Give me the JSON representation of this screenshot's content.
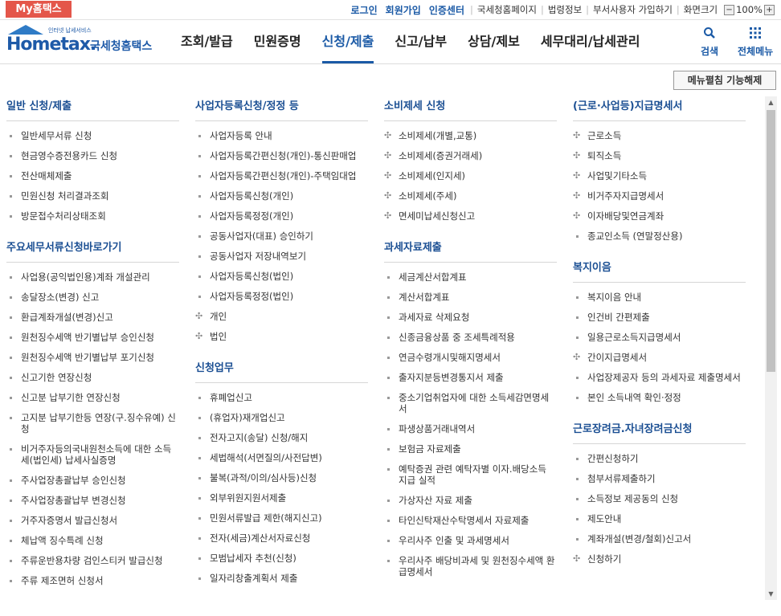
{
  "topbar": {
    "mytax": "My홈택스",
    "links_blue": [
      "로그인",
      "회원가입",
      "인증센터"
    ],
    "links_plain": [
      "국세청홈페이지",
      "법령정보",
      "부서사용자 가입하기",
      "화면크기"
    ],
    "zoom": "100%",
    "zoom_minus": "−",
    "zoom_plus": "+"
  },
  "header": {
    "logo_en": "Hometax.",
    "logo_small": "인터넷 납세서비스",
    "logo_ko": "국세청홈택스",
    "nav": [
      "조회/발급",
      "민원증명",
      "신청/제출",
      "신고/납부",
      "상담/제보",
      "세무대리/납세관리"
    ],
    "active_nav": "신청/제출",
    "search_label": "검색",
    "allmenu_label": "전체메뉴"
  },
  "menu_toggle": "메뉴펼침 기능해제",
  "columns": [
    {
      "sections": [
        {
          "title": "일반 신청/제출",
          "items": [
            {
              "label": "일반세무서류 신청",
              "mark": "bullet"
            },
            {
              "label": "현금영수증전용카드 신청",
              "mark": "bullet"
            },
            {
              "label": "전산매체제출",
              "mark": "bullet"
            },
            {
              "label": "민원신청 처리결과조회",
              "mark": "bullet"
            },
            {
              "label": "방문접수처리상태조회",
              "mark": "bullet"
            }
          ]
        },
        {
          "title": "주요세무서류신청바로가기",
          "items": [
            {
              "label": "사업용(공익법인용)계좌 개설관리",
              "mark": "bullet"
            },
            {
              "label": "송달장소(변경) 신고",
              "mark": "bullet"
            },
            {
              "label": "환급계좌개설(변경)신고",
              "mark": "bullet"
            },
            {
              "label": "원천징수세액 반기별납부 승인신청",
              "mark": "bullet"
            },
            {
              "label": "원천징수세액 반기별납부 포기신청",
              "mark": "bullet"
            },
            {
              "label": "신고기한 연장신청",
              "mark": "bullet"
            },
            {
              "label": "신고분 납부기한 연장신청",
              "mark": "bullet"
            },
            {
              "label": "고지분 납부기한등 연장(구.징수유예) 신청",
              "mark": "bullet"
            },
            {
              "label": "비거주자등의국내원천소득에 대한 소득세(법인세) 납세사실증명",
              "mark": "bullet"
            },
            {
              "label": "주사업장총괄납부 승인신청",
              "mark": "bullet"
            },
            {
              "label": "주사업장총괄납부 변경신청",
              "mark": "bullet"
            },
            {
              "label": "거주자증명서 발급신청서",
              "mark": "bullet"
            },
            {
              "label": "체납액 징수특례 신청",
              "mark": "bullet"
            },
            {
              "label": "주류운반용차량 검인스티커 발급신청",
              "mark": "bullet"
            },
            {
              "label": "주류 제조면허 신청서",
              "mark": "bullet"
            }
          ]
        }
      ]
    },
    {
      "sections": [
        {
          "title": "사업자등록신청/정정 등",
          "items": [
            {
              "label": "사업자등록 안내",
              "mark": "bullet"
            },
            {
              "label": "사업자등록간편신청(개인)-통신판매업",
              "mark": "bullet"
            },
            {
              "label": "사업자등록간편신청(개인)-주택임대업",
              "mark": "bullet"
            },
            {
              "label": "사업자등록신청(개인)",
              "mark": "bullet"
            },
            {
              "label": "사업자등록정정(개인)",
              "mark": "bullet"
            },
            {
              "label": "공동사업자(대표) 승인하기",
              "mark": "bullet"
            },
            {
              "label": "공동사업자 저장내역보기",
              "mark": "bullet"
            },
            {
              "label": "사업자등록신청(법인)",
              "mark": "bullet"
            },
            {
              "label": "사업자등록정정(법인)",
              "mark": "bullet"
            },
            {
              "label": "개인",
              "mark": "plus"
            },
            {
              "label": "법인",
              "mark": "plus"
            }
          ]
        },
        {
          "title": "신청업무",
          "items": [
            {
              "label": "휴폐업신고",
              "mark": "bullet"
            },
            {
              "label": "(휴업자)재개업신고",
              "mark": "bullet"
            },
            {
              "label": "전자고지(송달) 신청/해지",
              "mark": "bullet"
            },
            {
              "label": "세법해석(서면질의/사전답변)",
              "mark": "bullet"
            },
            {
              "label": "불복(과적/이의/심사등)신청",
              "mark": "bullet"
            },
            {
              "label": "외부위원지원서제출",
              "mark": "bullet"
            },
            {
              "label": "민원서류발급 제한(해지신고)",
              "mark": "bullet"
            },
            {
              "label": "전자(세금)계산서자료신청",
              "mark": "bullet"
            },
            {
              "label": "모범납세자 추천(신청)",
              "mark": "bullet"
            },
            {
              "label": "일자리창출계획서 제출",
              "mark": "bullet"
            }
          ]
        }
      ]
    },
    {
      "sections": [
        {
          "title": "소비제세 신청",
          "items": [
            {
              "label": "소비제세(개별,교통)",
              "mark": "plus"
            },
            {
              "label": "소비제세(증권거래세)",
              "mark": "plus"
            },
            {
              "label": "소비제세(인지세)",
              "mark": "plus"
            },
            {
              "label": "소비제세(주세)",
              "mark": "plus"
            },
            {
              "label": "면세미납세신청신고",
              "mark": "plus"
            }
          ]
        },
        {
          "title": "과세자료제출",
          "items": [
            {
              "label": "세금계산서합계표",
              "mark": "bullet"
            },
            {
              "label": "계산서합계표",
              "mark": "bullet"
            },
            {
              "label": "과세자료 삭제요청",
              "mark": "bullet"
            },
            {
              "label": "신종금융상품 중 조세특례적용",
              "mark": "bullet"
            },
            {
              "label": "연금수령개시및해지명세서",
              "mark": "bullet"
            },
            {
              "label": "출자지분등변경통지서 제출",
              "mark": "bullet"
            },
            {
              "label": "중소기업취업자에 대한 소득세감면명세서",
              "mark": "bullet"
            },
            {
              "label": "파생상품거래내역서",
              "mark": "bullet"
            },
            {
              "label": "보험금 자료제출",
              "mark": "bullet"
            },
            {
              "label": "예탁증권 관련 예탁자별 이자.배당소득 지급 실적",
              "mark": "bullet"
            },
            {
              "label": "가상자산 자료 제출",
              "mark": "bullet"
            },
            {
              "label": "타인신탁재산수탁명세서 자료제출",
              "mark": "bullet"
            },
            {
              "label": "우리사주 인출 및 과세명세서",
              "mark": "bullet"
            },
            {
              "label": "우리사주 배당비과세 및 원천징수세액 환급명세서",
              "mark": "bullet"
            }
          ]
        }
      ]
    },
    {
      "sections": [
        {
          "title": "(근로·사업등)지급명세서",
          "items": [
            {
              "label": "근로소득",
              "mark": "plus"
            },
            {
              "label": "퇴직소득",
              "mark": "plus"
            },
            {
              "label": "사업및기타소득",
              "mark": "plus"
            },
            {
              "label": "비거주자지급명세서",
              "mark": "plus"
            },
            {
              "label": "이자배당및연금계좌",
              "mark": "plus"
            },
            {
              "label": "종교인소득 (연말정산용)",
              "mark": "bullet"
            }
          ]
        },
        {
          "title": "복지이음",
          "items": [
            {
              "label": "복지이음 안내",
              "mark": "bullet"
            },
            {
              "label": "인건비 간편제출",
              "mark": "bullet"
            },
            {
              "label": "일용근로소득지급명세서",
              "mark": "bullet"
            },
            {
              "label": "간이지급명세서",
              "mark": "plus"
            },
            {
              "label": "사업장제공자 등의 과세자료 제출명세서",
              "mark": "bullet"
            },
            {
              "label": "본인 소득내역 확인·정정",
              "mark": "bullet"
            }
          ]
        },
        {
          "title": "근로장려금.자녀장려금신청",
          "items": [
            {
              "label": "간편신청하기",
              "mark": "bullet"
            },
            {
              "label": "첨부서류제출하기",
              "mark": "bullet"
            },
            {
              "label": "소득정보 제공동의 신청",
              "mark": "bullet"
            },
            {
              "label": "제도안내",
              "mark": "bullet"
            },
            {
              "label": "계좌개설(변경/철회)신고서",
              "mark": "bullet"
            },
            {
              "label": "신청하기",
              "mark": "plus"
            }
          ]
        }
      ]
    }
  ]
}
